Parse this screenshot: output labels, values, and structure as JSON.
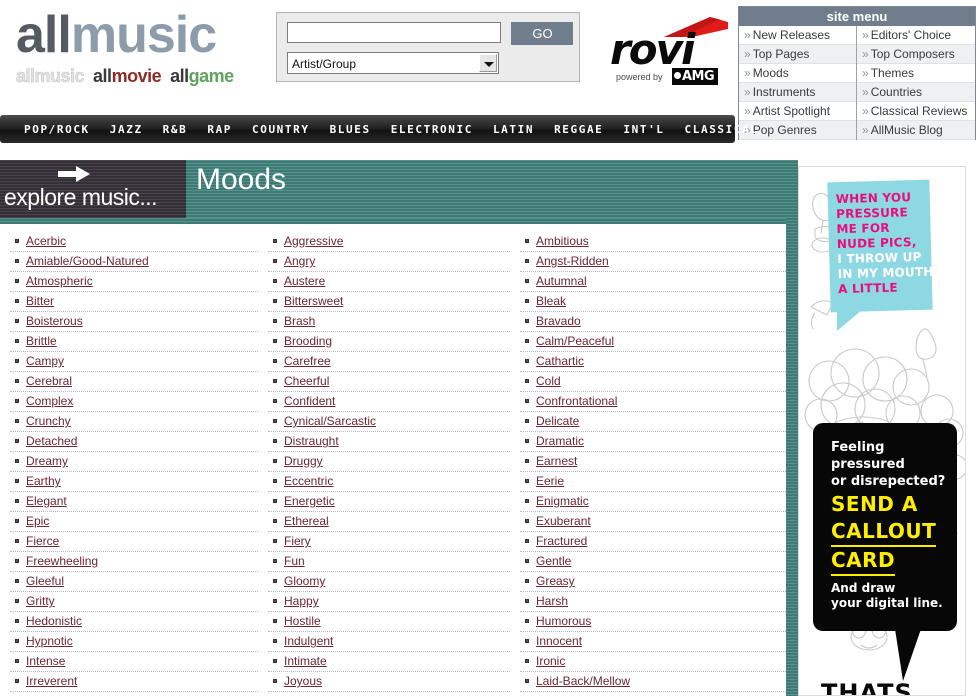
{
  "brand": {
    "logo_all": "all",
    "logo_music": "music",
    "sub_allmusic": "allmusic",
    "sub_all1": "all",
    "sub_movie": "movie",
    "sub_all2": "all",
    "sub_game": "game"
  },
  "search": {
    "value": "",
    "placeholder": "",
    "go_label": "GO",
    "selected_option": "Artist/Group",
    "options": [
      "Artist/Group"
    ]
  },
  "rovi": {
    "wordmark": "rovi",
    "powered_by": "powered by",
    "amg": "AMG"
  },
  "site_menu": {
    "title": "site menu",
    "left": [
      "New Releases",
      "Top Pages",
      "Moods",
      "Instruments",
      "Artist Spotlight",
      "Pop Genres"
    ],
    "right": [
      "Editors' Choice",
      "Top Composers",
      "Themes",
      "Countries",
      "Classical Reviews",
      "AllMusic Blog"
    ],
    "chevron": "»"
  },
  "genre_nav": [
    "POP/ROCK",
    "JAZZ",
    "R&B",
    "RAP",
    "COUNTRY",
    "BLUES",
    "ELECTRONIC",
    "LATIN",
    "REGGAE",
    "INT'L",
    "CLASSICAL"
  ],
  "explore": {
    "label": "explore music...",
    "arrow_icon": "arrow-right-icon"
  },
  "page": {
    "title": "Moods"
  },
  "moods": {
    "column1": [
      "Acerbic",
      "Amiable/Good-Natured",
      "Atmospheric",
      "Bitter",
      "Boisterous",
      "Brittle",
      "Campy",
      "Cerebral",
      "Complex",
      "Crunchy",
      "Detached",
      "Dreamy",
      "Earthy",
      "Elegant",
      "Epic",
      "Fierce",
      "Freewheeling",
      "Gleeful",
      "Gritty",
      "Hedonistic",
      "Hypnotic",
      "Intense",
      "Irreverent"
    ],
    "column2": [
      "Aggressive",
      "Angry",
      "Austere",
      "Bittersweet",
      "Brash",
      "Brooding",
      "Carefree",
      "Cheerful",
      "Confident",
      "Cynical/Sarcastic",
      "Distraught",
      "Druggy",
      "Eccentric",
      "Energetic",
      "Ethereal",
      "Fiery",
      "Fun",
      "Gloomy",
      "Happy",
      "Hostile",
      "Indulgent",
      "Intimate",
      "Joyous"
    ],
    "column3": [
      "Ambitious",
      "Angst-Ridden",
      "Autumnal",
      "Bleak",
      "Bravado",
      "Calm/Peaceful",
      "Cathartic",
      "Cold",
      "Confrontational",
      "Delicate",
      "Dramatic",
      "Earnest",
      "Eerie",
      "Enigmatic",
      "Exuberant",
      "Fractured",
      "Gentle",
      "Greasy",
      "Harsh",
      "Humorous",
      "Innocent",
      "Ironic",
      "Laid-Back/Mellow"
    ]
  },
  "ad": {
    "bubble1_lines": [
      {
        "text": "WHEN YOU",
        "color": "pink"
      },
      {
        "text": "PRESSURE",
        "color": "pink"
      },
      {
        "text": "ME FOR",
        "color": "pink"
      },
      {
        "text": "NUDE PICS,",
        "color": "pink"
      },
      {
        "text": "I THROW UP",
        "color": "white"
      },
      {
        "text": "IN MY MOUTH",
        "color": "white"
      },
      {
        "text": "A LITTLE",
        "color": "pink"
      }
    ],
    "headline_line1": "Feeling pressured",
    "headline_line2": "or disrepected?",
    "cta_line1": "SEND A",
    "cta_line2": "CALLOUT",
    "cta_line3": "CARD",
    "footer_line1": "And draw",
    "footer_line2": "your digital line.",
    "bottom_text": "THATS",
    "colors": {
      "bubble_blue": "#8ed8e4",
      "pink": "#ec0a7f",
      "yellow": "#ffee00",
      "black": "#070707"
    }
  },
  "colors": {
    "accent_teal": "#3d7a74",
    "header_blue_gray": "#6f7d8c",
    "link_maroon": "#6b2733"
  }
}
